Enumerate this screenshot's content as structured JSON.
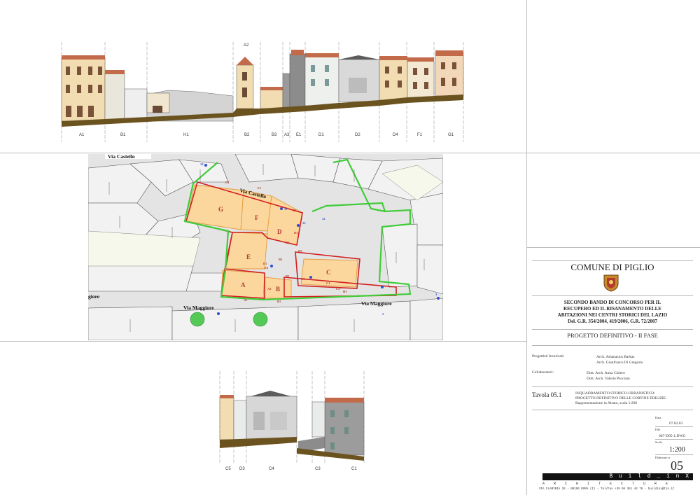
{
  "elevation_top": {
    "bay_labels": [
      "A1",
      "B1",
      "H1",
      "B2",
      "B3",
      "A3",
      "E1",
      "D1",
      "D2",
      "D4",
      "F1",
      "G1"
    ],
    "callout": "A2"
  },
  "plan": {
    "streets": {
      "via_castello_top": "Via Castello",
      "via_castello_mid": "Via Castello",
      "via_maggiore_left": "Via Maggiore",
      "via_maggiore_right": "Via Maggiore",
      "fragment_left": "giore"
    },
    "blocks": [
      "G",
      "F",
      "D",
      "E",
      "C",
      "A",
      "B"
    ],
    "refs": [
      "G1",
      "F1",
      "D1",
      "E1",
      "D3",
      "D2",
      "C1",
      "C2",
      "A1",
      "B1",
      "A2",
      "B2",
      "B3",
      "E3",
      "D5",
      "A3",
      "H1"
    ],
    "arrow_tags": [
      "14",
      "11",
      "12",
      "12",
      "2",
      "3"
    ],
    "colors": {
      "block_fill": "#fbd79e",
      "block_edge": "#e39a3c",
      "lot_outline": "#d21f1f",
      "cortina": "#41cc3a"
    }
  },
  "elevation_bottom": {
    "bay_labels": [
      "C5",
      "D3",
      "C4",
      "C3",
      "C1"
    ]
  },
  "title_block": {
    "municipality": "COMUNE DI PIGLIO",
    "heading_lines": [
      "SECONDO BANDO DI CONCORSO PER IL",
      "RECUPERO ED IL RISANAMENTO DELLE",
      "ABITAZIONI NEI CENTRI STORICI DEL LAZIO",
      "Del. G.R. 354/2004, 419/2006, G.R. 72/2007"
    ],
    "phase": "PROGETTO DEFINITIVO - II FASE",
    "designers_label": "Progettisti Incaricati:",
    "designers": [
      "Arch. Athanasios Barkas",
      "Arch. Gianfranco Di Gregorio"
    ],
    "collaborators_label": "Collaboratori:",
    "collaborators": [
      "Dott. Arch. Anna Cisiero",
      "Dott. Arch. Valerio Pacciani"
    ],
    "sheet_no": "Tavola 05.1",
    "sheet_desc": [
      "INQUADRAMENTO STORICO-URBANISTICO:",
      "PROGETTO DEFINITIVO DELLE CORTINE EDILIZIE",
      "Rappresentazione in Alzato, scala 1:200"
    ],
    "data_label": "Data",
    "data_value": "07.02.03",
    "file_label": "File",
    "file_value": "067-D05-1.DWG",
    "scale_label": "Scala",
    "scale_value": "1:200",
    "elab_label": "Elaborato n.",
    "elab_value": "05",
    "brand": "B u i l d _ i n X",
    "brand_sub": "A R C H I T E C T U R E",
    "footer": "VIA FLAMINIA 26 - 00196 ROMA (I) - Tel/Fax +39 06 361 44 78 - buildinx@tin.it"
  }
}
